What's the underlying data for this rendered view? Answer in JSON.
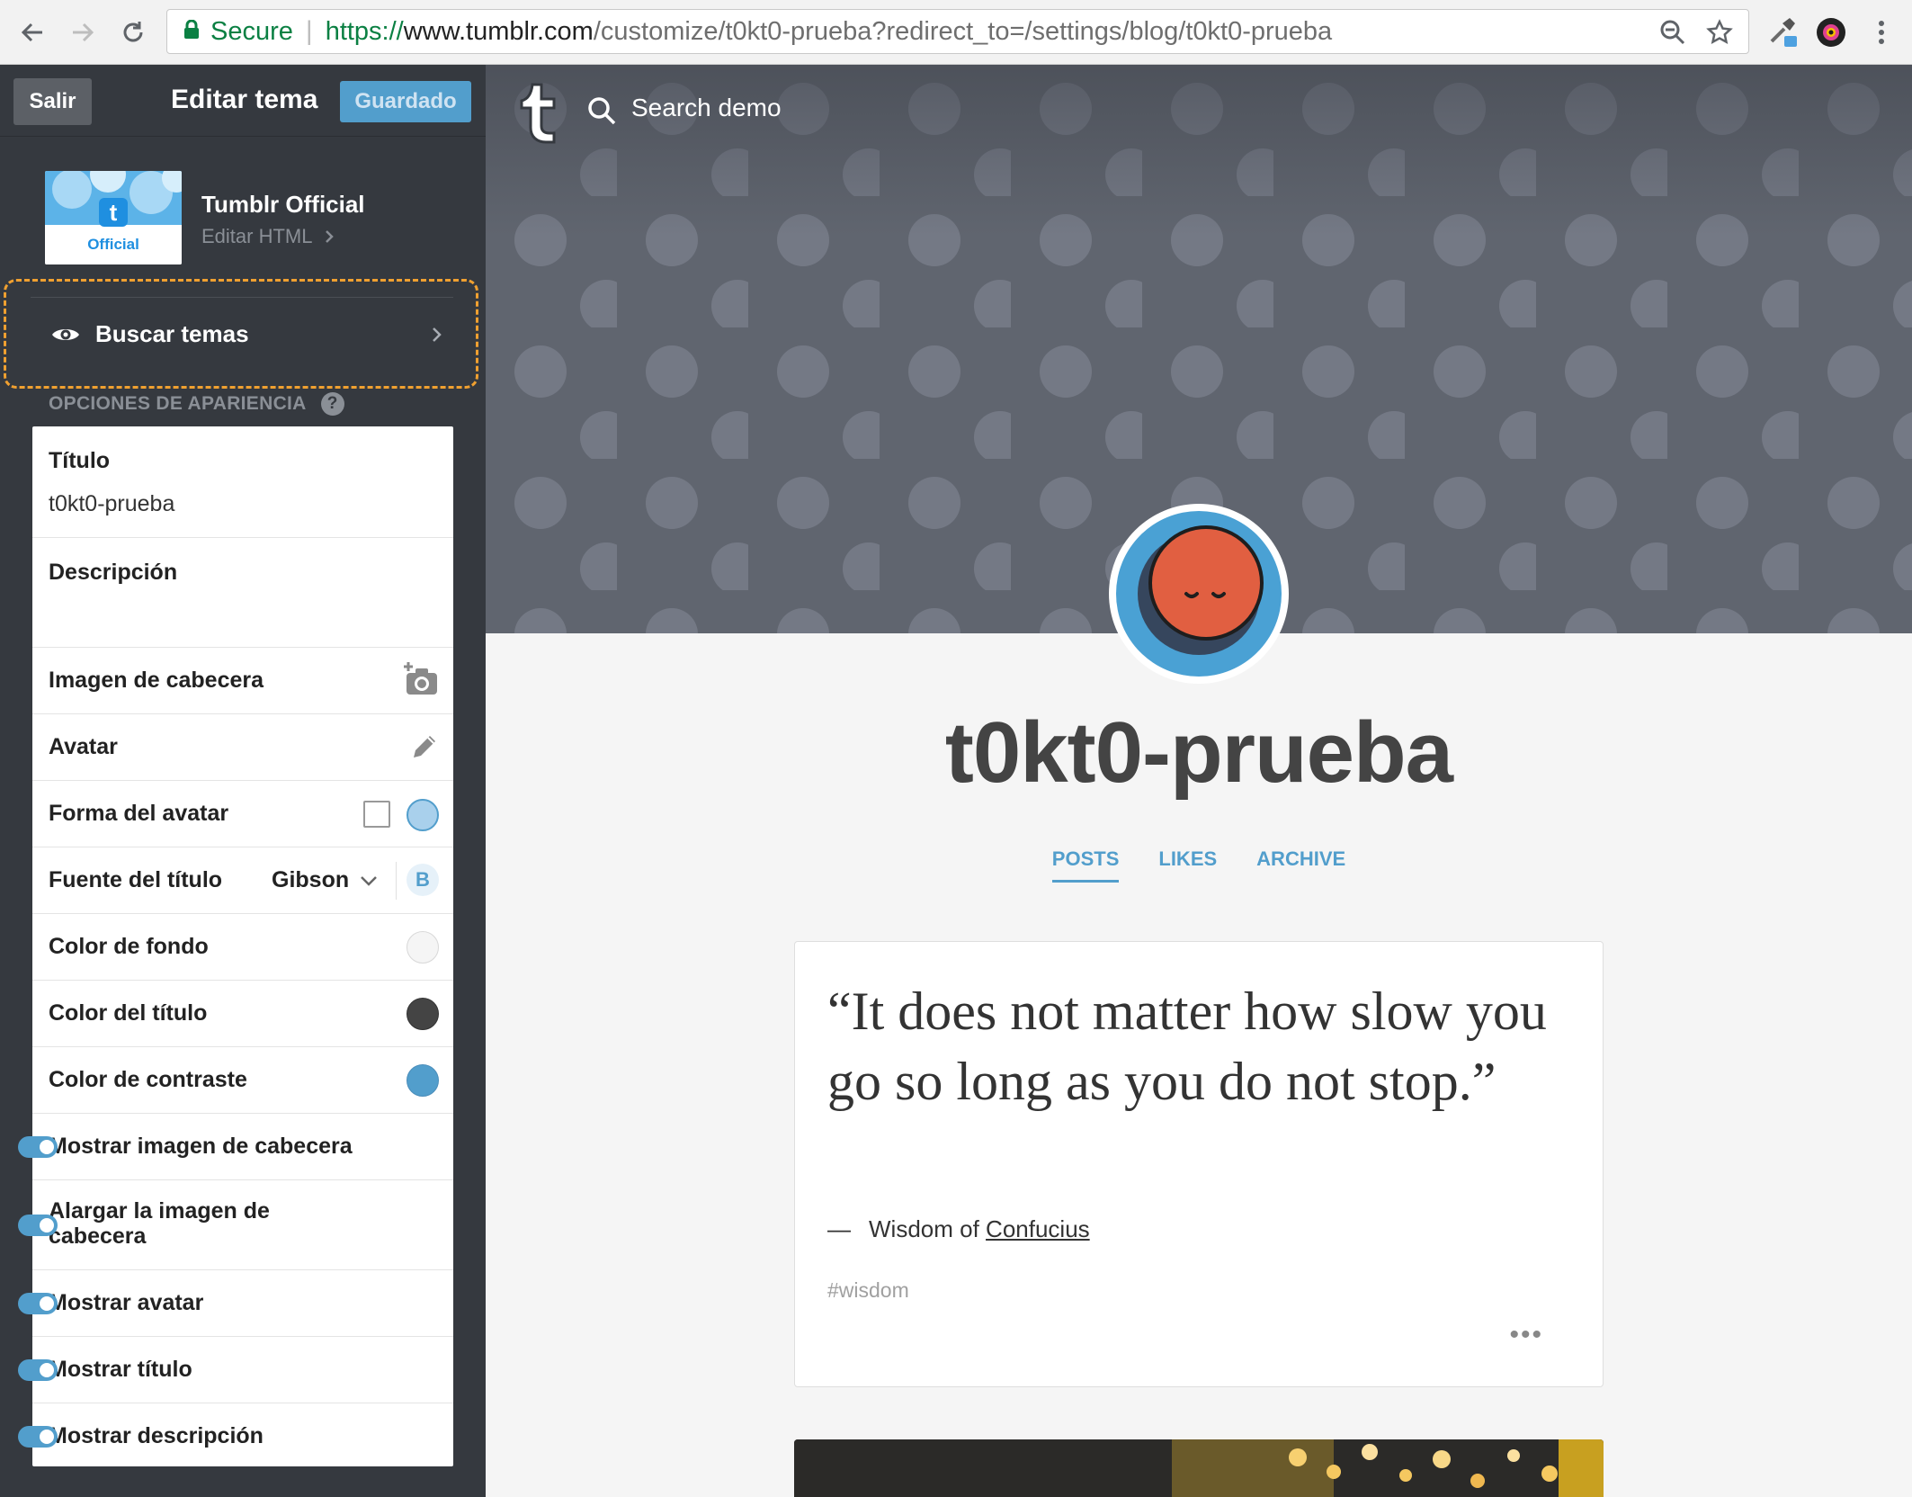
{
  "browser": {
    "secure_label": "Secure",
    "url_scheme": "https://",
    "url_host": "www.tumblr.com",
    "url_path": "/customize/t0kt0-prueba?redirect_to=/settings/blog/t0kt0-prueba"
  },
  "sidebar": {
    "exit_label": "Salir",
    "title": "Editar tema",
    "saved_label": "Guardado",
    "theme_thumb_label": "Official",
    "theme_name": "Tumblr Official",
    "edit_html_label": "Editar HTML",
    "browse_themes_label": "Buscar temas",
    "appearance_heading": "OPCIONES DE APARIENCIA",
    "help_glyph": "?",
    "title_field": {
      "label": "Título",
      "value": "t0kt0-prueba"
    },
    "description_field": {
      "label": "Descripción",
      "value": ""
    },
    "header_image_label": "Imagen de cabecera",
    "avatar_label": "Avatar",
    "avatar_shape_label": "Forma del avatar",
    "title_font_label": "Fuente del título",
    "title_font_value": "Gibson",
    "bold_glyph": "B",
    "bg_color_label": "Color de fondo",
    "title_color_label": "Color del título",
    "accent_color_label": "Color de contraste",
    "show_header_label": "Mostrar imagen de cabecera",
    "stretch_header_label": "Alargar la imagen de cabecera",
    "show_avatar_label": "Mostrar avatar",
    "show_title_label": "Mostrar título",
    "show_description_label": "Mostrar descripción",
    "toggles": {
      "show_header": true,
      "stretch_header": true,
      "show_avatar": true,
      "show_title": true,
      "show_description": true
    }
  },
  "colors": {
    "background": "#f5f5f5",
    "title": "#444444",
    "accent": "#529ecc",
    "sidebar_bg": "#35393f",
    "highlight_border": "#f0a030"
  },
  "preview": {
    "search_label": "Search demo",
    "blog_title": "t0kt0-prueba",
    "tabs": [
      "POSTS",
      "LIKES",
      "ARCHIVE"
    ],
    "active_tab": "POSTS",
    "post": {
      "quote": "“It does not matter how slow you go so long as you do not stop.”",
      "source_dash": "—",
      "source_prefix": "Wisdom of",
      "source_link": "Confucius",
      "tag": "#wisdom",
      "more_glyph": "•••"
    }
  }
}
